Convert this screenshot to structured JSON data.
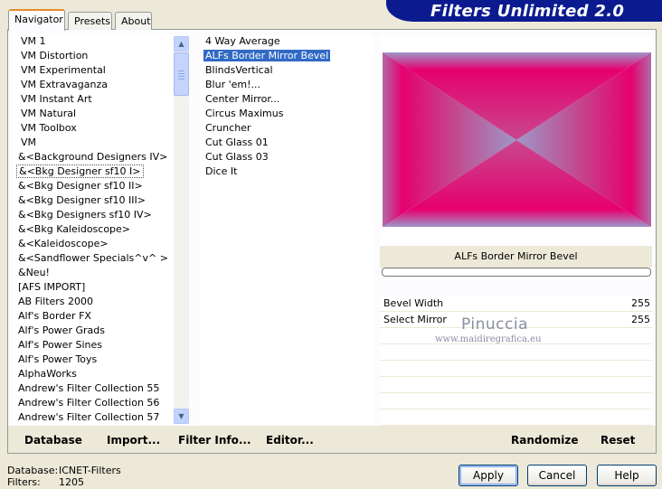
{
  "tabs": [
    "Navigator",
    "Presets",
    "About"
  ],
  "banner_title": "Filters Unlimited 2.0",
  "categories": [
    "VM 1",
    "VM Distortion",
    "VM Experimental",
    "VM Extravaganza",
    "VM Instant Art",
    "VM Natural",
    "VM Toolbox",
    "VM",
    "&<Background Designers IV>",
    "&<Bkg Designer sf10 I>",
    "&<Bkg Designer sf10 II>",
    "&<Bkg Designer sf10 III>",
    "&<Bkg Designers sf10 IV>",
    "&<Bkg Kaleidoscope>",
    "&<Kaleidoscope>",
    "&<Sandflower Specials^v^ >",
    "&Neu!",
    "[AFS IMPORT]",
    "AB Filters 2000",
    "Alf's Border FX",
    "Alf's Power Grads",
    "Alf's Power Sines",
    "Alf's Power Toys",
    "AlphaWorks",
    "Andrew's Filter Collection 55",
    "Andrew's Filter Collection 56",
    "Andrew's Filter Collection 57"
  ],
  "selected_category": "&<Bkg Designer sf10 I>",
  "filters": [
    "4 Way Average",
    "ALFs Border Mirror Bevel",
    "BlindsVertical",
    "Blur 'em!...",
    "Center Mirror...",
    "Circus Maximus",
    "Cruncher",
    "Cut Glass 01",
    "Cut Glass 03",
    "Dice It"
  ],
  "selected_filter": "ALFs Border Mirror Bevel",
  "preview": {
    "colors": {
      "magenta": "#e6006e",
      "lavender": "#9e97c9"
    }
  },
  "filter_title": "ALFs Border Mirror Bevel",
  "params": [
    {
      "label": "Bevel Width",
      "value": "255"
    },
    {
      "label": "Select Mirror",
      "value": "255"
    }
  ],
  "watermark": {
    "line1": "Pinuccia",
    "line2": "www.maidiregrafica.eu"
  },
  "bottom_buttons": {
    "database": "Database",
    "import": "Import...",
    "filter_info": "Filter Info...",
    "editor": "Editor...",
    "randomize": "Randomize",
    "reset": "Reset"
  },
  "status": {
    "database_label": "Database:",
    "database_value": "ICNET-Filters",
    "filters_label": "Filters:",
    "filters_value": "1205"
  },
  "dialog_buttons": {
    "apply": "Apply",
    "cancel": "Cancel",
    "help": "Help"
  }
}
